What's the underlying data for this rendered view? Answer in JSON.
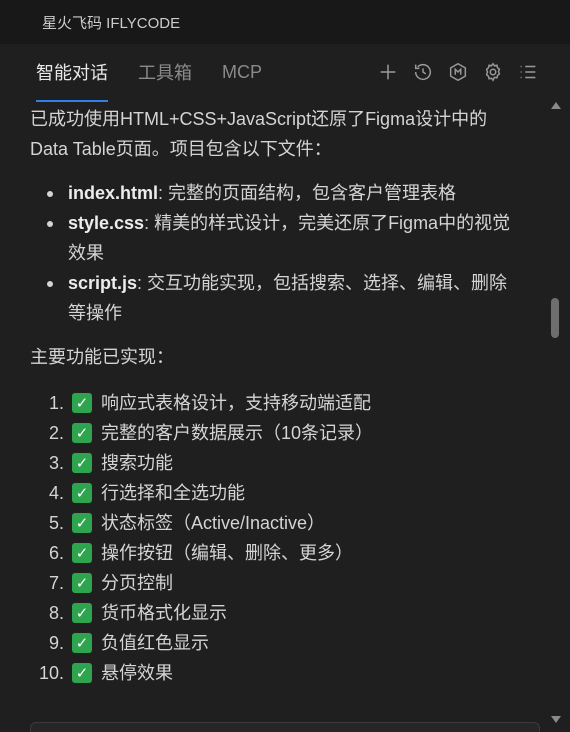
{
  "window": {
    "title": "星火飞码 IFLYCODE"
  },
  "tabs": [
    {
      "label": "智能对话",
      "active": true
    },
    {
      "label": "工具箱",
      "active": false
    },
    {
      "label": "MCP",
      "active": false
    }
  ],
  "toolbar_icons": [
    "plus-icon",
    "history-icon",
    "model-icon",
    "gear-icon",
    "list-icon"
  ],
  "message": {
    "intro": "已成功使用HTML+CSS+JavaScript还原了Figma设计中的Data Table页面。项目包含以下文件：",
    "files": [
      {
        "name": "index.html",
        "desc": ": 完整的页面结构，包含客户管理表格"
      },
      {
        "name": "style.css",
        "desc": ": 精美的样式设计，完美还原了Figma中的视觉效果"
      },
      {
        "name": "script.js",
        "desc": ": 交互功能实现，包括搜索、选择、编辑、删除等操作"
      }
    ],
    "features_title": "主要功能已实现：",
    "features": [
      {
        "num": "1.",
        "text": "响应式表格设计，支持移动端适配"
      },
      {
        "num": "2.",
        "text": "完整的客户数据展示（10条记录）"
      },
      {
        "num": "3.",
        "text": "搜索功能"
      },
      {
        "num": "4.",
        "text": "行选择和全选功能"
      },
      {
        "num": "5.",
        "text": "状态标签（Active/Inactive）"
      },
      {
        "num": "6.",
        "text": "操作按钮（编辑、删除、更多）"
      },
      {
        "num": "7.",
        "text": "分页控制"
      },
      {
        "num": "8.",
        "text": "货币格式化显示"
      },
      {
        "num": "9.",
        "text": "负值红色显示"
      },
      {
        "num": "10.",
        "text": "悬停效果"
      }
    ],
    "check_glyph": "✓"
  },
  "colors": {
    "accent": "#2f80ed",
    "check": "#2ea44f",
    "background": "#1f1f1f"
  }
}
